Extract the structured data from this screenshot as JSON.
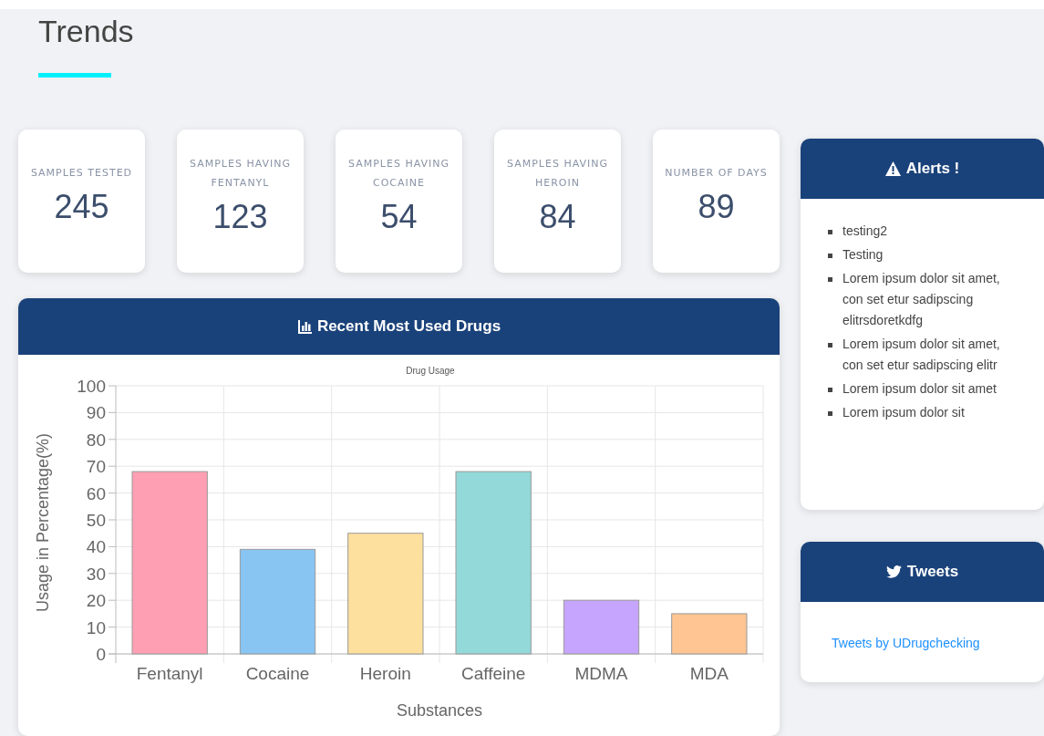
{
  "page": {
    "title": "Trends"
  },
  "stats": [
    {
      "label": "SAMPLES TESTED",
      "value": "245"
    },
    {
      "label": "SAMPLES HAVING FENTANYL",
      "value": "123"
    },
    {
      "label": "SAMPLES HAVING COCAINE",
      "value": "54"
    },
    {
      "label": "SAMPLES HAVING HEROIN",
      "value": "84"
    },
    {
      "label": "NUMBER OF DAYS",
      "value": "89"
    }
  ],
  "drugs_panel": {
    "title": "Recent Most Used Drugs",
    "chart_data": {
      "type": "bar",
      "title": "Drug Usage",
      "xlabel": "Substances",
      "ylabel": "Usage in Percentage(%)",
      "categories": [
        "Fentanyl",
        "Cocaine",
        "Heroin",
        "Caffeine",
        "MDMA",
        "MDA"
      ],
      "values": [
        68,
        39,
        45,
        68,
        20,
        15
      ],
      "colors": [
        "#ff9fb3",
        "#88c5f2",
        "#fee09e",
        "#94d9d9",
        "#c5a5fe",
        "#ffc592"
      ],
      "grid": true,
      "ylim": [
        0,
        100
      ],
      "yticks": [
        0,
        10,
        20,
        30,
        40,
        50,
        60,
        70,
        80,
        90,
        100
      ]
    }
  },
  "alerts": {
    "title": "Alerts !",
    "items": [
      "testing2",
      "Testing",
      "Lorem ipsum dolor sit amet, con set etur sadipscing elitrsdoretkdfg",
      "Lorem ipsum dolor sit amet, con set etur sadipscing elitr",
      "Lorem ipsum dolor sit amet",
      "Lorem ipsum dolor sit"
    ]
  },
  "tweets": {
    "title": "Tweets",
    "link": "Tweets by UDrugchecking"
  }
}
